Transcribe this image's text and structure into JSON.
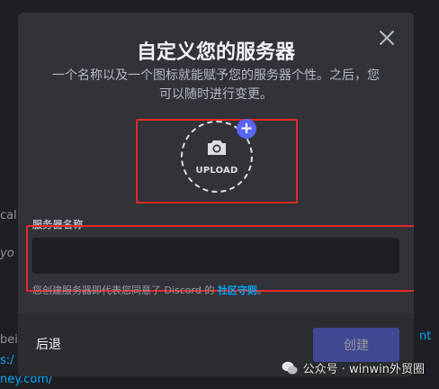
{
  "background": {
    "left_fragments": [
      "cal",
      "yo",
      "bei"
    ],
    "link_fragments": [
      "s:/",
      "ney.com/"
    ],
    "right_link_fragment": "nt"
  },
  "modal": {
    "title": "自定义您的服务器",
    "subtitle": "一个名称以及一个图标就能赋予您的服务器个性。之后，您可以随时进行变更。",
    "close_icon": "close-icon",
    "upload": {
      "label": "UPLOAD",
      "icon": "camera-icon",
      "badge_icon": "plus-icon"
    },
    "server_name": {
      "label": "服务器名称",
      "value": "",
      "placeholder": ""
    },
    "terms": {
      "prefix": "您创建服务器即代表您同意了 Discord 的",
      "link": "社区守则",
      "suffix": "。"
    },
    "footer": {
      "back_label": "后退",
      "create_label": "创建"
    }
  },
  "watermark": {
    "text": "公众号 · winwin外贸圈"
  },
  "colors": {
    "modal_bg": "#313338",
    "footer_bg": "#2b2d31",
    "accent": "#5865f2",
    "link": "#00a8fc",
    "highlight_box": "#e02a2a"
  }
}
